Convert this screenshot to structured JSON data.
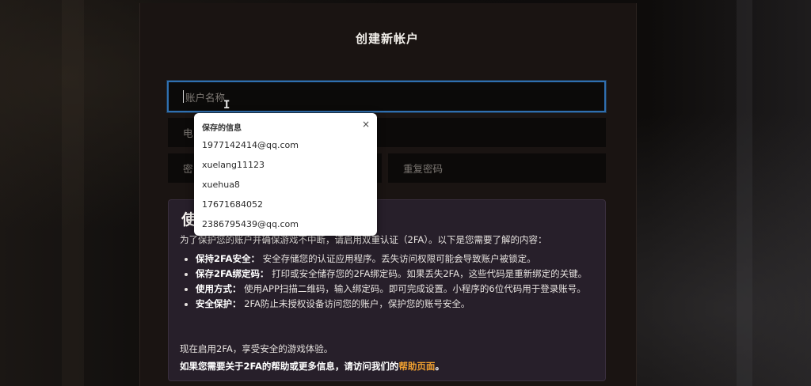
{
  "form": {
    "title": "创建新帐户",
    "username_placeholder": "账户名称",
    "email_placeholder": "电",
    "password_placeholder": "密",
    "confirm_password_placeholder": "重复密码"
  },
  "autofill": {
    "header": "保存的信息",
    "close_icon": "×",
    "items": [
      "1977142414@qq.com",
      "xuelang11123",
      "xuehua8",
      "17671684052",
      "2386795439@qq.com"
    ]
  },
  "info": {
    "heading": "使",
    "intro": "为了保护您的账户并确保游戏不中断，请启用双重认证（2FA）。以下是您需要了解的内容：",
    "bullets": [
      {
        "label": "保持2FA安全：",
        "text": "安全存储您的认证应用程序。丢失访问权限可能会导致账户被锁定。"
      },
      {
        "label": "保存2FA绑定码：",
        "text": "打印或安全储存您的2FA绑定码。如果丢失2FA，这些代码是重新绑定的关键。"
      },
      {
        "label": "使用方式：",
        "text": "使用APP扫描二维码，输入绑定码。即可完成设置。小程序的6位代码用于登录账号。"
      },
      {
        "label": "安全保护：",
        "text": "2FA防止未授权设备访问您的账户，保护您的账号安全。"
      }
    ],
    "outro": "现在启用2FA，享受安全的游戏体验。",
    "help_prefix": "如果您需要关于2FA的帮助或更多信息，请访问我们的",
    "help_link": "帮助页面",
    "help_suffix": "。"
  },
  "colors": {
    "accent_focus": "#2f6fb0",
    "help_link": "#f0a030",
    "info_bg": "#271f2a"
  }
}
